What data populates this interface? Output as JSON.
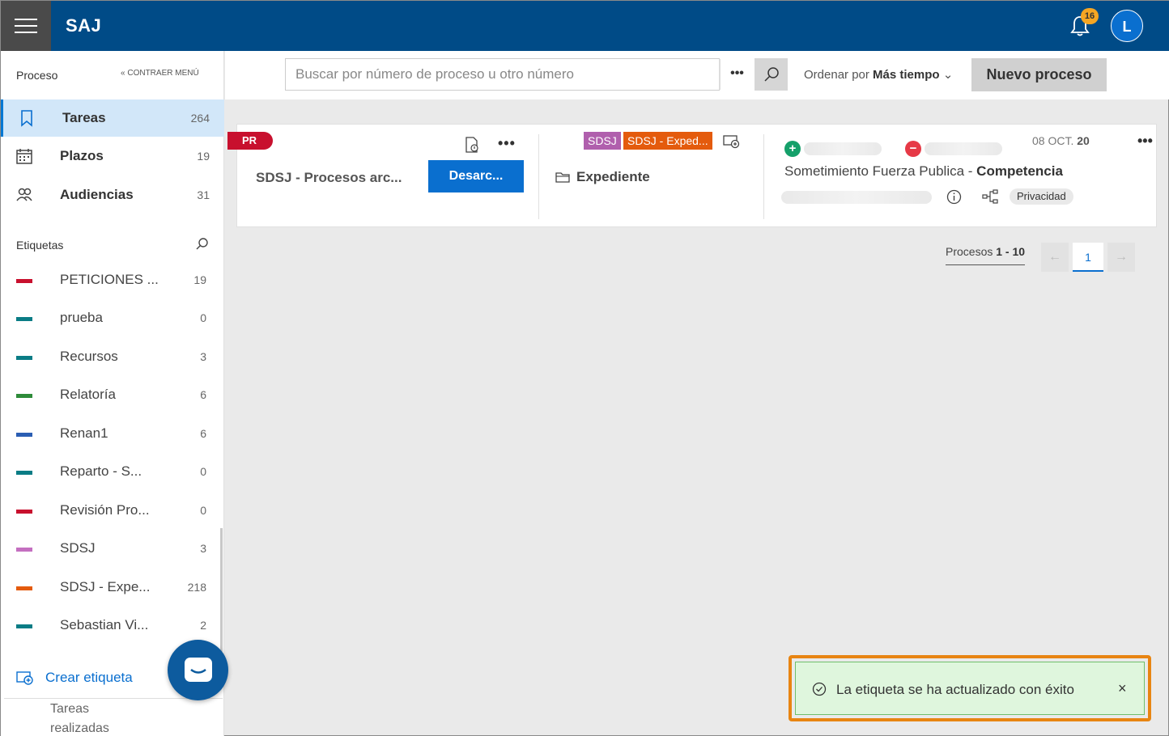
{
  "app": {
    "title": "SAJ",
    "notifications_count": "16",
    "avatar_initial": "L"
  },
  "sidebar": {
    "header": "Proceso",
    "collapse_label": "CONTRAER MENÚ",
    "nav": [
      {
        "label": "Tareas",
        "count": "264",
        "icon": "bookmark-icon"
      },
      {
        "label": "Plazos",
        "count": "19",
        "icon": "calendar-icon"
      },
      {
        "label": "Audiencias",
        "count": "31",
        "icon": "people-icon"
      }
    ],
    "tags_title": "Etiquetas",
    "tags": [
      {
        "label": "PETICIONES ...",
        "count": "19",
        "color": "#c8102e"
      },
      {
        "label": "prueba",
        "count": "0",
        "color": "#0a7c85"
      },
      {
        "label": "Recursos",
        "count": "3",
        "color": "#0a7c85"
      },
      {
        "label": "Relatoría",
        "count": "6",
        "color": "#2e8b3a"
      },
      {
        "label": "Renan1",
        "count": "6",
        "color": "#2b5eb3"
      },
      {
        "label": "Reparto - S...",
        "count": "0",
        "color": "#0a7c85"
      },
      {
        "label": "Revisión Pro...",
        "count": "0",
        "color": "#c8102e"
      },
      {
        "label": "SDSJ",
        "count": "3",
        "color": "#c46fc0"
      },
      {
        "label": "SDSJ - Expe...",
        "count": "218",
        "color": "#e45b0d"
      },
      {
        "label": "Sebastian Vi...",
        "count": "2",
        "color": "#0a7c85"
      }
    ],
    "create_tag": "Crear etiqueta",
    "done_tasks": "Tareas realizadas"
  },
  "toolbar": {
    "search_placeholder": "Buscar por número de proceso u otro número",
    "more": "•••",
    "sort_prefix": "Ordenar por",
    "sort_value": "Más tiempo",
    "new_process": "Nuevo proceso"
  },
  "card": {
    "badge": "PR",
    "title": "SDSJ - Procesos arc...",
    "action": "Desarc...",
    "chips": [
      "SDSJ",
      "SDSJ - Exped..."
    ],
    "folder_label": "Expediente",
    "date_prefix": "08 OCT.",
    "date_year": "20",
    "subject": "Sometimiento Fuerza Publica -",
    "subject_bold": "Competencia",
    "privacy": "Privacidad",
    "more": "•••"
  },
  "pagination": {
    "label": "Procesos",
    "range": "1 - 10",
    "current": "1",
    "prev": "←",
    "next": "→"
  },
  "toast": {
    "message": "La etiqueta se ha actualizado con éxito",
    "close": "×"
  }
}
